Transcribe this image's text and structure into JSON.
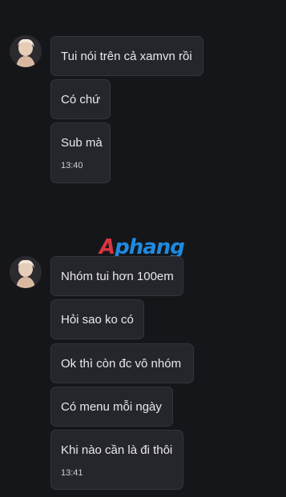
{
  "watermark": {
    "part1": "A",
    "part2": "phang"
  },
  "groups": [
    {
      "messages": [
        {
          "text": "Tui nói trên cả xamvn rồi"
        },
        {
          "text": "Có chứ"
        },
        {
          "text": "Sub mà",
          "time": "13:40"
        }
      ]
    },
    {
      "messages": [
        {
          "text": "Nhóm tui hơn 100em"
        },
        {
          "text": "Hỏi sao ko có"
        },
        {
          "text": "Ok thì còn đc vô nhóm"
        },
        {
          "text": "Có menu mỗi ngày"
        },
        {
          "text": "Khi nào cần là đi thôi",
          "time": "13:41"
        }
      ]
    }
  ]
}
